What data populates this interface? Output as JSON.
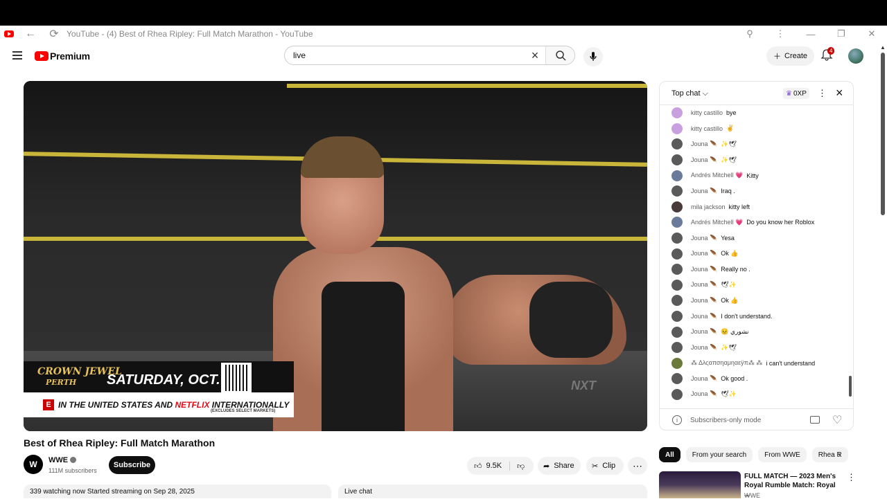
{
  "browser": {
    "tab_title": "YouTube - (4) Best of Rhea Ripley: Full Match Marathon - YouTube",
    "icons": [
      "youtube-favicon",
      "back-arrow-icon",
      "reload-icon",
      "zoom-icon",
      "more-vert-icon",
      "minimize-icon",
      "restore-icon",
      "close-icon"
    ]
  },
  "header": {
    "logo_text": "Premium",
    "search_query": "live",
    "create_label": "Create",
    "notification_count": "4"
  },
  "video": {
    "ad_brand_line1": "CROWN JEWEL",
    "ad_brand_line2": "PERTH",
    "ad_date": "SATURDAY, OCT. 11",
    "ad_bar_prefix": "IN THE UNITED STATES AND ",
    "ad_bar_netflix": "NETFLIX",
    "ad_bar_suffix": " INTERNATIONALLY",
    "ad_bar_sub": "(EXCLUDES SELECT MARKETS)",
    "watermark": "NXT",
    "title": "Best of Rhea Ripley: Full Match Marathon"
  },
  "channel": {
    "logo": "W",
    "name": "WWE",
    "subscribers": "111M subscribers",
    "subscribe_label": "Subscribe"
  },
  "actions": {
    "likes": "9.5K",
    "share_label": "Share",
    "clip_label": "Clip"
  },
  "description": {
    "meta": "339 watching now  Started streaming on Sep 28, 2025"
  },
  "livechat_tab": "Live chat",
  "chat": {
    "filter_label": "Top chat",
    "xp_label": "0XP",
    "messages": [
      {
        "author": "kitty castillo",
        "text": "bye",
        "color": "#c8a0e0"
      },
      {
        "author": "kitty castillo",
        "text": "✌",
        "color": "#c8a0e0"
      },
      {
        "author": "Jouna 🪶",
        "text": "✨🕊",
        "color": "#5a5a5a"
      },
      {
        "author": "Jouna 🪶",
        "text": "✨🕊",
        "color": "#5a5a5a"
      },
      {
        "author": "Andrés Mitchell 💗",
        "text": "Kitty",
        "color": "#6a7a9a"
      },
      {
        "author": "Jouna 🪶",
        "text": "Iraq .",
        "color": "#5a5a5a"
      },
      {
        "author": "mila jackson",
        "text": "kitty left",
        "color": "#4a3a3a"
      },
      {
        "author": "Andrés Mitchell 💗",
        "text": "Do you know her Roblox",
        "color": "#6a7a9a"
      },
      {
        "author": "Jouna 🪶",
        "text": "Yesa",
        "color": "#5a5a5a"
      },
      {
        "author": "Jouna 🪶",
        "text": "Ok 👍",
        "color": "#5a5a5a"
      },
      {
        "author": "Jouna 🪶",
        "text": "Really no .",
        "color": "#5a5a5a"
      },
      {
        "author": "Jouna 🪶",
        "text": "🕊✨",
        "color": "#5a5a5a"
      },
      {
        "author": "Jouna 🪶",
        "text": "Ok 👍",
        "color": "#5a5a5a"
      },
      {
        "author": "Jouna 🪶",
        "text": "I don't understand.",
        "color": "#5a5a5a"
      },
      {
        "author": "Jouna 🪶",
        "text": "😣 نشوري",
        "color": "#5a5a5a"
      },
      {
        "author": "Jouna 🪶",
        "text": "✨🕊",
        "color": "#5a5a5a"
      },
      {
        "author": "⁂ Δλςαπσηαμηαεÿπ⁂ ⁂",
        "text": "i can't understand",
        "color": "#6a7a3a"
      },
      {
        "author": "Jouna 🪶",
        "text": "Ok good .",
        "color": "#5a5a5a"
      },
      {
        "author": "Jouna 🪶",
        "text": "🕊✨",
        "color": "#5a5a5a"
      }
    ],
    "footer_text": "Subscribers-only mode"
  },
  "recommendations": {
    "chips": [
      "All",
      "From your search",
      "From WWE",
      "Rhea R"
    ],
    "first": {
      "title": "FULL MATCH — 2023 Men's Royal Rumble Match: Royal ...",
      "channel": "WWE"
    }
  }
}
